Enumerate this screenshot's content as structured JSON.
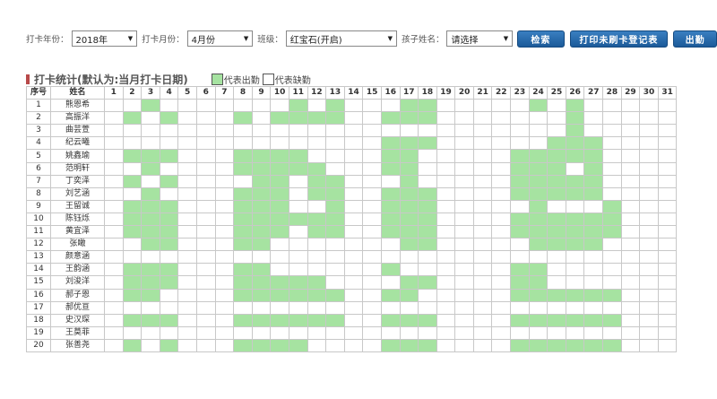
{
  "filters": {
    "year_label": "打卡年份：",
    "year_value": "2018年",
    "month_label": "打卡月份：",
    "month_value": "4月份",
    "class_label": "班级：",
    "class_value": "红宝石(开启)",
    "child_label": "孩子姓名：",
    "child_value": "请选择"
  },
  "buttons": {
    "search": "检索",
    "print": "打印未刷卡登记表",
    "export": "出勤"
  },
  "section": {
    "title": "打卡统计(默认为:当月打卡日期)",
    "legend_present": "代表出勤",
    "legend_absent": "代表缺勤"
  },
  "colors": {
    "present": "#a6e3a1",
    "button": "#2a6db0",
    "title_marker": "#b84a4a"
  },
  "table": {
    "col_index": "序号",
    "col_name": "姓名",
    "days": [
      "1",
      "2",
      "3",
      "4",
      "5",
      "6",
      "7",
      "8",
      "9",
      "10",
      "11",
      "12",
      "13",
      "14",
      "15",
      "16",
      "17",
      "18",
      "19",
      "20",
      "21",
      "22",
      "23",
      "24",
      "25",
      "26",
      "27",
      "28",
      "29",
      "30",
      "31"
    ],
    "rows": [
      {
        "no": "1",
        "name": "熊恩希",
        "present": [
          3,
          11,
          13,
          17,
          18,
          24,
          26
        ]
      },
      {
        "no": "2",
        "name": "高振洋",
        "present": [
          2,
          4,
          8,
          10,
          11,
          12,
          13,
          16,
          17,
          18,
          26
        ]
      },
      {
        "no": "3",
        "name": "曲芸萱",
        "present": [
          26
        ]
      },
      {
        "no": "4",
        "name": "纪云曦",
        "present": [
          16,
          17,
          18,
          25,
          26,
          27
        ]
      },
      {
        "no": "5",
        "name": "姚鑫瑜",
        "present": [
          2,
          3,
          4,
          8,
          9,
          10,
          11,
          16,
          17,
          23,
          24,
          25,
          26,
          27
        ]
      },
      {
        "no": "6",
        "name": "范明轩",
        "present": [
          3,
          8,
          9,
          10,
          11,
          12,
          16,
          17,
          23,
          24,
          25,
          27
        ]
      },
      {
        "no": "7",
        "name": "丁奕泽",
        "present": [
          2,
          4,
          9,
          10,
          12,
          13,
          17,
          23,
          24,
          25,
          26,
          27
        ]
      },
      {
        "no": "8",
        "name": "刘艺涵",
        "present": [
          3,
          8,
          9,
          10,
          12,
          13,
          16,
          17,
          18,
          23,
          24,
          25,
          26,
          27
        ]
      },
      {
        "no": "9",
        "name": "王留诚",
        "present": [
          2,
          3,
          4,
          8,
          9,
          10,
          13,
          16,
          17,
          18,
          24,
          28
        ]
      },
      {
        "no": "10",
        "name": "陈钰烁",
        "present": [
          2,
          3,
          4,
          8,
          9,
          10,
          11,
          12,
          13,
          16,
          17,
          18,
          23,
          24,
          25,
          26,
          27,
          28
        ]
      },
      {
        "no": "11",
        "name": "黄宜泽",
        "present": [
          2,
          3,
          4,
          8,
          9,
          10,
          12,
          13,
          16,
          17,
          18,
          23,
          24,
          25,
          26,
          27,
          28
        ]
      },
      {
        "no": "12",
        "name": "张瞰",
        "present": [
          3,
          4,
          8,
          9,
          17,
          18,
          24,
          25,
          26,
          27
        ]
      },
      {
        "no": "13",
        "name": "颜意涵",
        "present": []
      },
      {
        "no": "14",
        "name": "王韵涵",
        "present": [
          2,
          3,
          4,
          8,
          9,
          16,
          23,
          24
        ]
      },
      {
        "no": "15",
        "name": "刘浚洋",
        "present": [
          2,
          3,
          4,
          8,
          9,
          10,
          11,
          12,
          17,
          18,
          23,
          24
        ]
      },
      {
        "no": "16",
        "name": "郝子恩",
        "present": [
          2,
          3,
          8,
          9,
          10,
          11,
          12,
          13,
          16,
          17,
          23,
          24,
          25,
          26,
          27,
          28
        ]
      },
      {
        "no": "17",
        "name": "郝优亘",
        "present": []
      },
      {
        "no": "18",
        "name": "史汉琛",
        "present": [
          2,
          3,
          4,
          8,
          9,
          10,
          11,
          12,
          13,
          16,
          17,
          18,
          23,
          24,
          25,
          26,
          27,
          28
        ]
      },
      {
        "no": "19",
        "name": "王莫菲",
        "present": []
      },
      {
        "no": "20",
        "name": "张善尧",
        "present": [
          2,
          4,
          8,
          9,
          10,
          11,
          16,
          17,
          18,
          23,
          24,
          25,
          26,
          27,
          28
        ]
      }
    ]
  }
}
